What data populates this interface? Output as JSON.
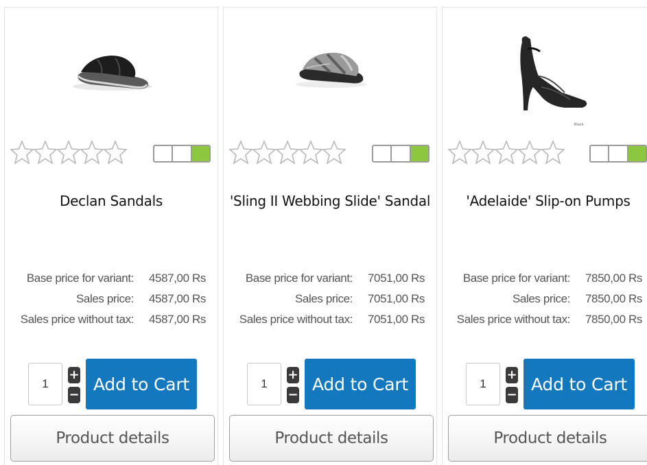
{
  "products": [
    {
      "name": "Declan Sandals",
      "image_icon": "black-slide-sandal-image",
      "rating_stars": 5,
      "rating_filled": 0,
      "stock_level": "green",
      "base_price_label": "Base price for variant:",
      "base_price": "4587,00 Rs",
      "sales_price_label": "Sales price:",
      "sales_price": "4587,00 Rs",
      "sales_price_no_tax_label": "Sales price without tax:",
      "sales_price_no_tax": "4587,00 Rs",
      "quantity": "1",
      "add_to_cart_label": "Add to Cart",
      "details_label": "Product details"
    },
    {
      "name": "'Sling II Webbing Slide' Sandal",
      "image_icon": "grey-webbing-sandal-image",
      "rating_stars": 5,
      "rating_filled": 0,
      "stock_level": "green",
      "base_price_label": "Base price for variant:",
      "base_price": "7051,00 Rs",
      "sales_price_label": "Sales price:",
      "sales_price": "7051,00 Rs",
      "sales_price_no_tax_label": "Sales price without tax:",
      "sales_price_no_tax": "7051,00 Rs",
      "quantity": "1",
      "add_to_cart_label": "Add to Cart",
      "details_label": "Product details"
    },
    {
      "name": "'Adelaide' Slip-on Pumps",
      "image_icon": "black-pump-shoe-image",
      "image_caption": "Black",
      "rating_stars": 5,
      "rating_filled": 0,
      "stock_level": "green",
      "base_price_label": "Base price for variant:",
      "base_price": "7850,00 Rs",
      "sales_price_label": "Sales price:",
      "sales_price": "7850,00 Rs",
      "sales_price_no_tax_label": "Sales price without tax:",
      "sales_price_no_tax": "7850,00 Rs",
      "quantity": "1",
      "add_to_cart_label": "Add to Cart",
      "details_label": "Product details"
    }
  ],
  "colors": {
    "add_to_cart": "#1478be",
    "stock_green": "#8dc63f",
    "star_outline": "#b9b9b9",
    "qty_button": "#3a3a3a"
  }
}
